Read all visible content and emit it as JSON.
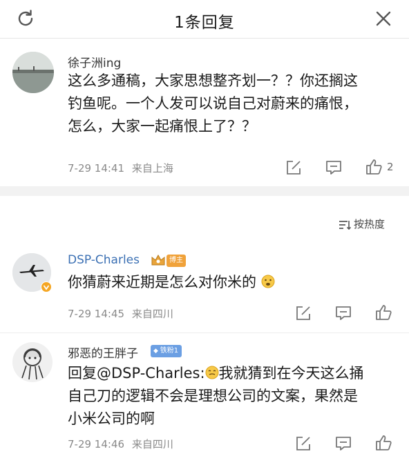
{
  "header": {
    "title": "1条回复"
  },
  "post": {
    "author": "徐子洲ing",
    "text_lines": [
      "这么多通稿，大家思想整齐划一？？你还搁这",
      "钓鱼呢。一个人发可以说自己对蔚来的痛恨，",
      "怎么，大家一起痛恨上了？？"
    ],
    "time": "7-29 14:41",
    "location": "来自上海",
    "likes": "2"
  },
  "sort": {
    "label": "按热度"
  },
  "comments": [
    {
      "author": "DSP-Charles",
      "badge": "博主",
      "text_lines": [
        "你猜蔚来近期是怎么对你米的"
      ],
      "time": "7-29 14:45",
      "location": "来自四川"
    },
    {
      "author": "邪恶的王胖子",
      "badge": "铁粉1",
      "text_lines": [
        "回复@DSP-Charles:",
        "我就猜到在今天这么捅",
        "自己刀的逻辑不会是理想公司的文案，果然是",
        "小米公司的啊"
      ],
      "time": "7-29 14:46",
      "location": "来自四川"
    }
  ],
  "colors": {
    "link": "#3a6fb3",
    "gold_badge": "#f0a23a",
    "blue_badge": "#6b9fe3",
    "meta": "#8a8a8a",
    "divider": "#f2f2f2"
  },
  "icons": [
    "refresh-icon",
    "close-icon",
    "share-icon",
    "comment-icon",
    "like-icon",
    "sort-icon",
    "crown-icon",
    "verified-icon",
    "emoji-icon"
  ]
}
